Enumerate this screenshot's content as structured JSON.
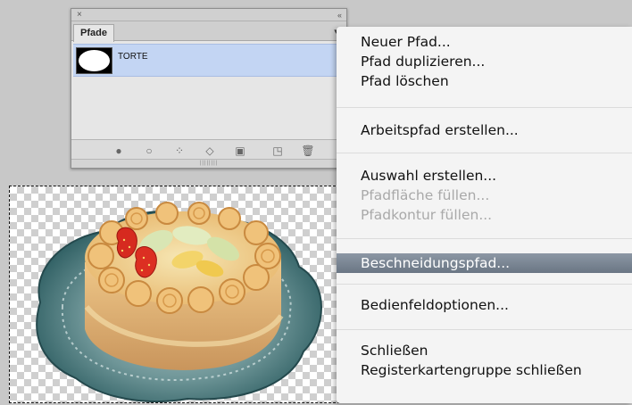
{
  "panel": {
    "tab_label": "Pfade",
    "close_glyph": "×",
    "collapse_glyph": "‹‹",
    "menu_glyph": "▾≡",
    "grip_glyph": "||||||||",
    "paths": [
      {
        "name": "TORTE",
        "selected": true
      }
    ],
    "footer_icons": [
      {
        "name": "fill-path-icon",
        "glyph": "●"
      },
      {
        "name": "stroke-path-icon",
        "glyph": "○"
      },
      {
        "name": "load-as-selection-icon",
        "glyph": "⁘"
      },
      {
        "name": "make-work-path-icon",
        "glyph": "◇"
      },
      {
        "name": "add-mask-icon",
        "glyph": "▣"
      },
      {
        "name": "new-path-icon",
        "glyph": "◳"
      },
      {
        "name": "delete-path-icon",
        "glyph": "🗑"
      }
    ]
  },
  "menu": {
    "items": [
      {
        "label": "Neuer Pfad...",
        "enabled": true
      },
      {
        "label": "Pfad duplizieren...",
        "enabled": true
      },
      {
        "label": "Pfad löschen",
        "enabled": true
      },
      {
        "label": "Arbeitspfad erstellen...",
        "enabled": true
      },
      {
        "label": "Auswahl erstellen...",
        "enabled": true
      },
      {
        "label": "Pfadfläche füllen...",
        "enabled": false
      },
      {
        "label": "Pfadkontur füllen...",
        "enabled": false
      },
      {
        "label": "Beschneidungspfad...",
        "enabled": true,
        "highlighted": true
      },
      {
        "label": "Bedienfeldoptionen...",
        "enabled": true
      },
      {
        "label": "Schließen",
        "enabled": true
      },
      {
        "label": "Registerkartengruppe schließen",
        "enabled": true
      }
    ]
  },
  "colors": {
    "selection_row": "#c3d5f3",
    "menu_highlight": "#7a8593",
    "disabled_text": "#a9a9a9"
  }
}
